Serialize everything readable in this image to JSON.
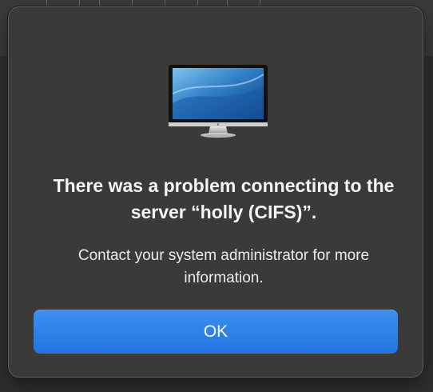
{
  "dialog": {
    "icon": "display-monitor-icon",
    "title": "There was a problem connecting to the server “holly (CIFS)”.",
    "message": "Contact your system administrator for more information.",
    "ok_label": "OK"
  },
  "colors": {
    "button": "#2a7fe8",
    "dialog_background": "#3a3a38",
    "text": "#f4f4f4"
  }
}
